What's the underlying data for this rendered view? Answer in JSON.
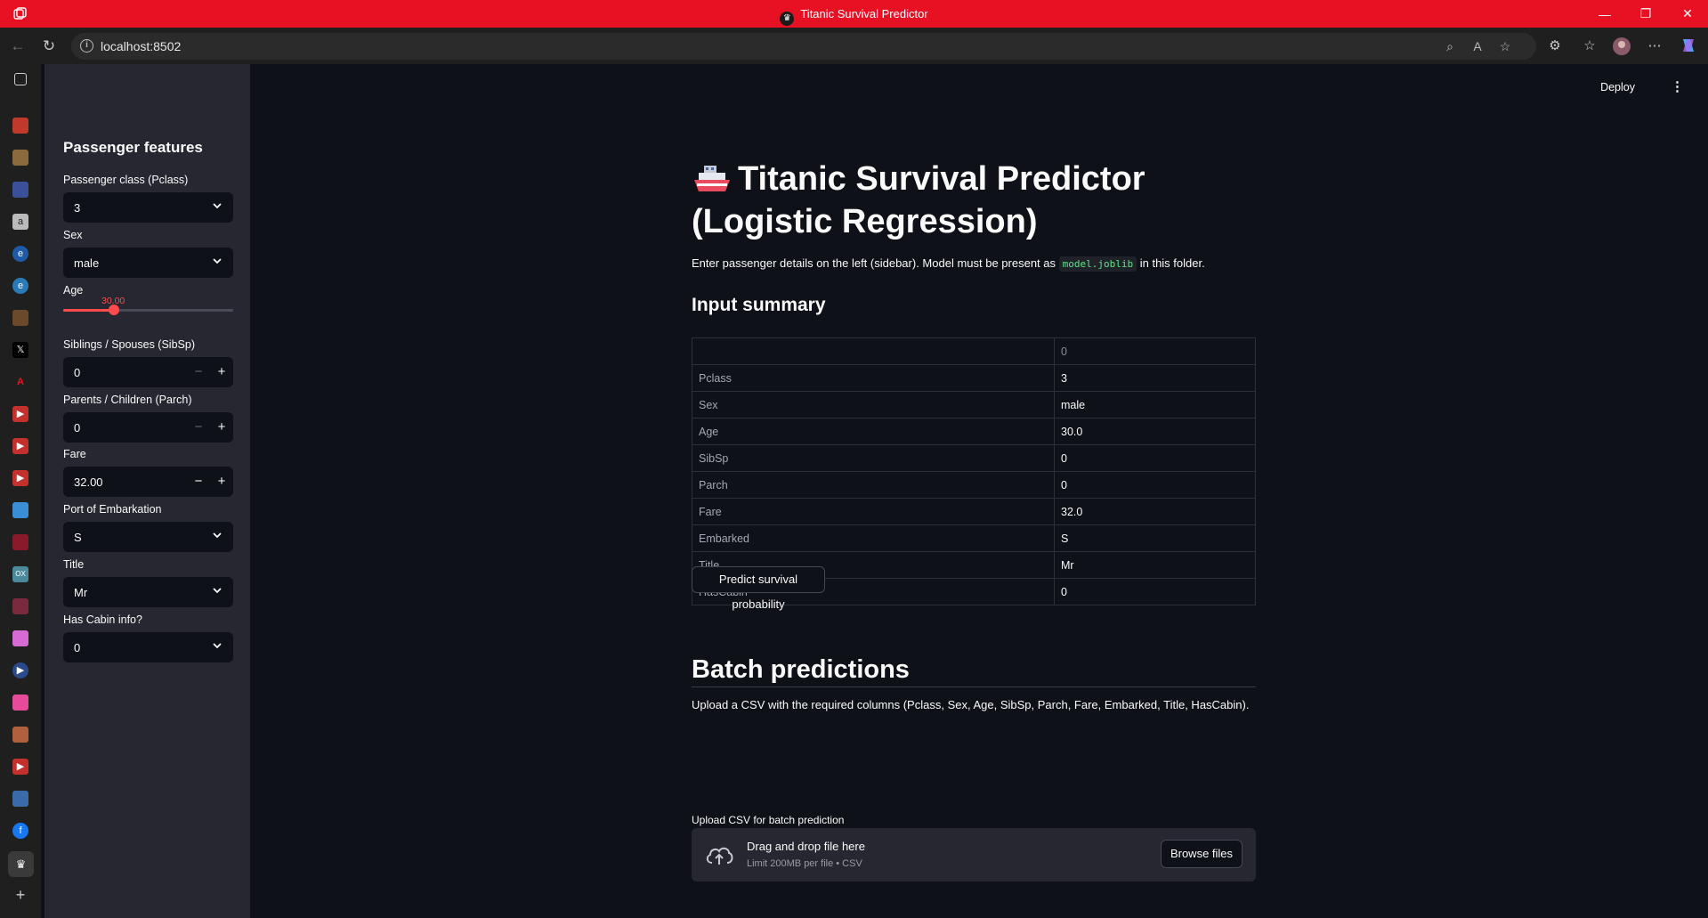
{
  "window": {
    "title": "Titanic Survival Predictor",
    "controls": {
      "minimize": "—",
      "restore": "❐",
      "close": "✕"
    }
  },
  "browser": {
    "url": "localhost:8502"
  },
  "header": {
    "deploy_label": "Deploy"
  },
  "sidebar": {
    "title": "Passenger features",
    "pclass": {
      "label": "Passenger class (Pclass)",
      "value": "3"
    },
    "sex": {
      "label": "Sex",
      "value": "male"
    },
    "age": {
      "label": "Age",
      "value": "30.00",
      "fraction": 0.3
    },
    "sibsp": {
      "label": "Siblings / Spouses (SibSp)",
      "value": "0",
      "minus": "−",
      "plus": "+"
    },
    "parch": {
      "label": "Parents / Children (Parch)",
      "value": "0",
      "minus": "−",
      "plus": "+"
    },
    "fare": {
      "label": "Fare",
      "value": "32.00",
      "minus": "−",
      "plus": "+"
    },
    "embarked": {
      "label": "Port of Embarkation",
      "value": "S"
    },
    "title_field": {
      "label": "Title",
      "value": "Mr"
    },
    "hascabin": {
      "label": "Has Cabin info?",
      "value": "0"
    }
  },
  "main": {
    "title": "Titanic Survival Predictor (Logistic Regression)",
    "intro_before": "Enter passenger details on the left (sidebar). Model must be present as ",
    "intro_code": "model.joblib",
    "intro_after": " in this folder.",
    "input_summary_heading": "Input summary",
    "table": {
      "column_header": "0",
      "rows": [
        {
          "index": "Pclass",
          "value": "3"
        },
        {
          "index": "Sex",
          "value": "male"
        },
        {
          "index": "Age",
          "value": "30.0"
        },
        {
          "index": "SibSp",
          "value": "0"
        },
        {
          "index": "Parch",
          "value": "0"
        },
        {
          "index": "Fare",
          "value": "32.0"
        },
        {
          "index": "Embarked",
          "value": "S"
        },
        {
          "index": "Title",
          "value": "Mr"
        },
        {
          "index": "HasCabin",
          "value": "0"
        }
      ]
    },
    "predict_button": "Predict survival probability",
    "batch_heading": "Batch predictions",
    "batch_desc": "Upload a CSV with the required columns (Pclass, Sex, Age, SibSp, Parch, Fare, Embarked, Title, HasCabin).",
    "upload_label": "Upload CSV for batch prediction",
    "dropzone_title": "Drag and drop file here",
    "dropzone_sub": "Limit 200MB per file • CSV",
    "browse_button": "Browse files"
  },
  "colors": {
    "titlebar": "#e81123",
    "accent": "#ff4b4b",
    "background": "#0e1117",
    "sidebar": "#262730",
    "code": "#5ce488"
  }
}
